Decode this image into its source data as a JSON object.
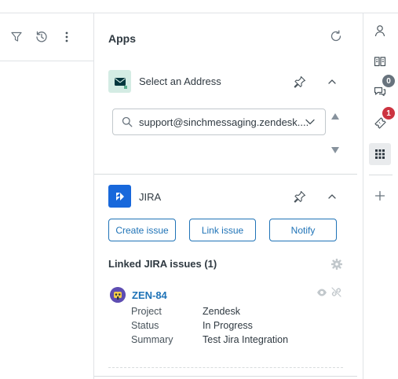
{
  "apps_panel": {
    "title": "Apps",
    "address_app": {
      "name": "Select an Address",
      "selected_address": "support@sinchmessaging.zendesk...."
    },
    "jira_app": {
      "name": "JIRA",
      "buttons": {
        "create": "Create issue",
        "link": "Link issue",
        "notify": "Notify"
      },
      "linked_title": "Linked JIRA issues (1)",
      "issue": {
        "key": "ZEN-84",
        "fields": [
          {
            "label": "Project",
            "value": "Zendesk"
          },
          {
            "label": "Status",
            "value": "In Progress"
          },
          {
            "label": "Summary",
            "value": "Test Jira Integration"
          }
        ]
      }
    }
  },
  "right_rail": {
    "conversations_badge": "0",
    "tickets_badge": "1"
  },
  "colors": {
    "accent": "#1f73b7",
    "jira_logo": "#1868db",
    "badge_dark": "#68737d",
    "badge_red": "#cc3340"
  },
  "icons": {
    "left_toolbar": [
      "filter-icon",
      "history-icon",
      "more-vertical-icon"
    ],
    "rail": [
      "user-icon",
      "knowledge-book-icon",
      "conversations-icon",
      "ticket-icon",
      "apps-grid-icon",
      "add-icon"
    ]
  }
}
